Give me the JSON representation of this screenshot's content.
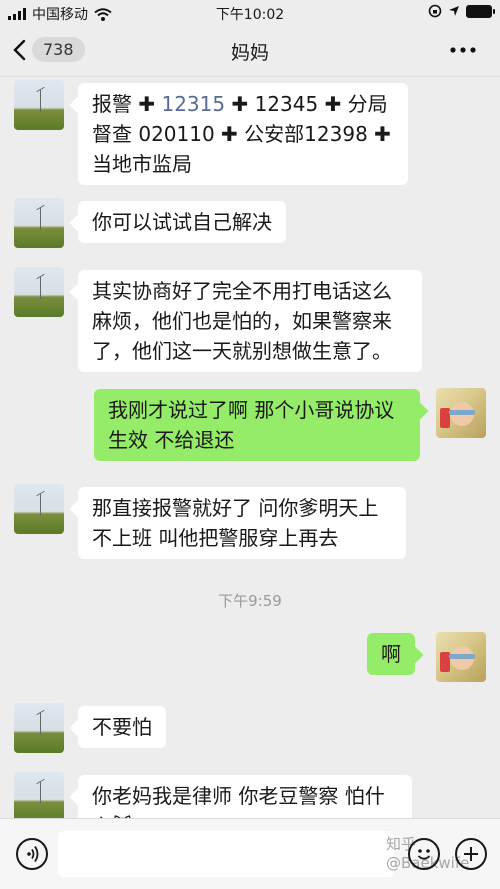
{
  "status_bar": {
    "carrier": "中国移动",
    "time": "下午10:02",
    "battery_level": 1.0
  },
  "nav": {
    "back_count": "738",
    "title": "妈妈"
  },
  "messages": [
    {
      "from": "other",
      "parts": [
        "报警 ✚ ",
        "12315",
        " ✚ 12345 ✚ 分局督查 020110 ✚ 公安部12398 ✚ 当地市监局"
      ]
    },
    {
      "from": "other",
      "text": "你可以试试自己解决"
    },
    {
      "from": "other",
      "text": "其实协商好了完全不用打电话这么麻烦，他们也是怕的，如果警察来了，他们这一天就别想做生意了。"
    },
    {
      "from": "self",
      "text": "我刚才说过了啊 那个小哥说协议生效 不给退还"
    },
    {
      "from": "other",
      "text": "那直接报警就好了 问你爹明天上不上班 叫他把警服穿上再去"
    },
    {
      "timestamp": "下午9:59"
    },
    {
      "from": "self",
      "text": "啊"
    },
    {
      "from": "other",
      "text": "不要怕"
    },
    {
      "from": "other",
      "text": "你老妈我是律师 你老豆警察 怕什么😸"
    }
  ],
  "input_bar": {
    "watermark": "知乎 @Baekwife"
  },
  "icons": {
    "voice": "voice-icon",
    "emoji": "emoji-icon",
    "plus": "plus-icon",
    "back": "chevron-left-icon",
    "more": "more-icon",
    "wifi": "wifi-icon",
    "lock": "rotation-lock-icon",
    "location": "location-icon"
  },
  "colors": {
    "bubble_self": "#95ec69",
    "bubble_other": "#ffffff",
    "background": "#ededed",
    "link": "#576b95"
  }
}
